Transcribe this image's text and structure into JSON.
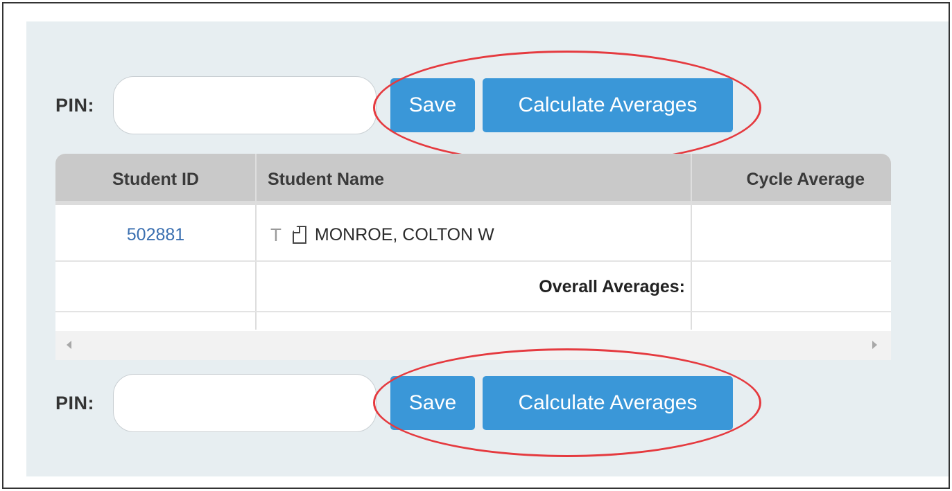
{
  "top_bar": {
    "pin_label": "PIN:",
    "pin_value": "",
    "save_label": "Save",
    "calc_label": "Calculate Averages"
  },
  "bottom_bar": {
    "pin_label": "PIN:",
    "pin_value": "",
    "save_label": "Save",
    "calc_label": "Calculate Averages"
  },
  "table": {
    "headers": [
      "Student ID",
      "Student Name",
      "Cycle Average"
    ],
    "rows": [
      {
        "student_id": "502881",
        "student_name": "MONROE, COLTON W",
        "cycle_average": ""
      }
    ],
    "overall_label": "Overall Averages:"
  },
  "icons": {
    "row_flag": "T",
    "row_doc": "document-icon"
  },
  "colors": {
    "button": "#3a97d8",
    "callout": "#e53a3f",
    "panel": "#e7eef1",
    "link": "#3a6fb0"
  }
}
